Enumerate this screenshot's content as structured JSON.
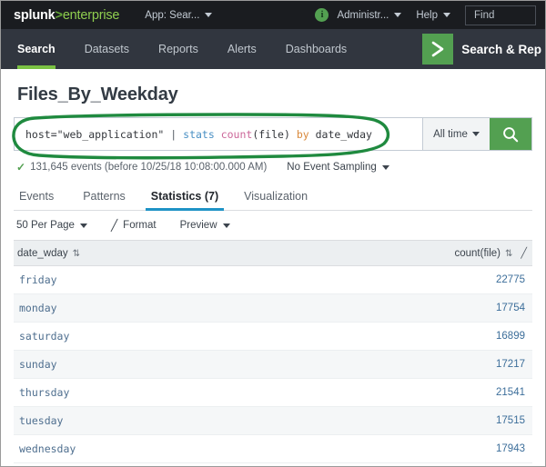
{
  "topbar": {
    "logo_main": "splunk",
    "logo_gt": ">",
    "logo_sub": "enterprise",
    "app_selector": "App: Sear...",
    "info_icon_label": "i",
    "user_menu": "Administr...",
    "help_menu": "Help",
    "find_placeholder": "Find",
    "find_value": "Find"
  },
  "nav": {
    "items": [
      {
        "label": "Search",
        "active": true
      },
      {
        "label": "Datasets",
        "active": false
      },
      {
        "label": "Reports",
        "active": false
      },
      {
        "label": "Alerts",
        "active": false
      },
      {
        "label": "Dashboards",
        "active": false
      }
    ],
    "app_badge_icon": "chevron-right-icon",
    "app_name": "Search & Rep"
  },
  "page": {
    "title": "Files_By_Weekday"
  },
  "search": {
    "query_full": "host=\"web_application\" | stats count(file) by date_wday",
    "tokens": {
      "host": "host=\"web_application\"",
      "pipe": "|",
      "stats": "stats",
      "count": "count",
      "file_arg": "(file)",
      "by": "by",
      "field": "date_wday"
    },
    "time_range": "All time",
    "search_icon": "magnifier-icon"
  },
  "status": {
    "check_icon": "check-icon",
    "events_text": "131,645 events (before 10/25/18 10:08:00.000 AM)",
    "sampling": "No Event Sampling"
  },
  "tabs": [
    {
      "label": "Events",
      "active": false
    },
    {
      "label": "Patterns",
      "active": false
    },
    {
      "label": "Statistics (7)",
      "active": true
    },
    {
      "label": "Visualization",
      "active": false
    }
  ],
  "toolbar": {
    "per_page": "50 Per Page",
    "format": "Format",
    "format_icon": "pencil-icon",
    "preview": "Preview"
  },
  "table": {
    "columns": [
      {
        "label": "date_wday",
        "align": "left",
        "sortable": true
      },
      {
        "label": "count(file)",
        "align": "right",
        "sortable": true,
        "editable": true
      }
    ],
    "rows": [
      {
        "date_wday": "friday",
        "count_file": "22775"
      },
      {
        "date_wday": "monday",
        "count_file": "17754"
      },
      {
        "date_wday": "saturday",
        "count_file": "16899"
      },
      {
        "date_wday": "sunday",
        "count_file": "17217"
      },
      {
        "date_wday": "thursday",
        "count_file": "21541"
      },
      {
        "date_wday": "tuesday",
        "count_file": "17515"
      },
      {
        "date_wday": "wednesday",
        "count_file": "17943"
      }
    ]
  },
  "annotation": {
    "shape": "hand-drawn-oval",
    "color": "#1f8a3f",
    "target": "search-query-bar"
  },
  "colors": {
    "topbar_bg": "#1a1c20",
    "navbar_bg": "#31363f",
    "splunk_green": "#53a051",
    "nav_active_underline": "#7ac143",
    "tab_active_underline": "#1e93c6",
    "table_header_bg": "#eceff1",
    "link_blue": "#3c6e9a"
  }
}
